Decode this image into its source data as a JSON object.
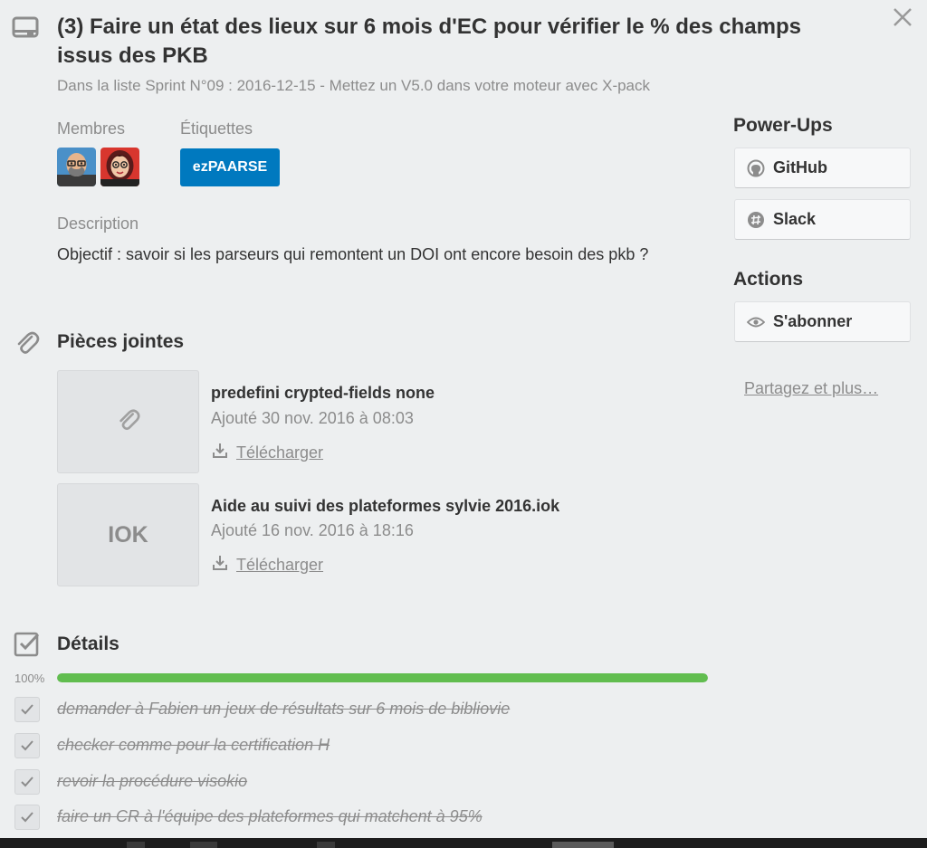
{
  "card": {
    "title": "(3) Faire un état des lieux sur 6 mois d'EC pour vérifier le % des champs issus des PKB",
    "list_info": "Dans la liste Sprint N°09 : 2016-12-15 - Mettez un V5.0 dans votre moteur avec X-pack"
  },
  "members": {
    "label": "Membres",
    "avatars": [
      "bald-man-avatar",
      "woman-glasses-avatar"
    ]
  },
  "labels": {
    "label": "Étiquettes",
    "items": [
      {
        "text": "ezPAARSE",
        "color": "#0079bf"
      }
    ]
  },
  "description": {
    "label": "Description",
    "text": "Objectif : savoir si les parseurs qui remontent un DOI ont encore besoin des pkb ?"
  },
  "attachments": {
    "heading": "Pièces jointes",
    "items": [
      {
        "thumb_icon": "paperclip-icon",
        "thumb_text": "",
        "name": "predefini crypted-fields none",
        "added": "Ajouté 30 nov. 2016 à 08:03",
        "download_label": "Télécharger"
      },
      {
        "thumb_icon": "",
        "thumb_text": "IOK",
        "name": "Aide au suivi des plateformes sylvie 2016.iok",
        "added": "Ajouté 16 nov. 2016 à 18:16",
        "download_label": "Télécharger"
      }
    ]
  },
  "checklist": {
    "heading": "Détails",
    "progress_label": "100%",
    "progress_fraction": 1.0,
    "progress_color": "#61bd4f",
    "items": [
      {
        "text": "demander à Fabien un jeux de résultats sur 6 mois de bibliovie",
        "checked": true
      },
      {
        "text": "checker comme pour la certification H",
        "checked": true
      },
      {
        "text": "revoir la procédure visokio",
        "checked": true
      },
      {
        "text": "faire un CR à l'équipe des plateformes qui matchent à 95%",
        "checked": true
      }
    ]
  },
  "sidebar": {
    "powerups_heading": "Power-Ups",
    "github_label": "GitHub",
    "slack_label": "Slack",
    "actions_heading": "Actions",
    "subscribe_label": "S'abonner",
    "share_label": "Partagez et plus…"
  }
}
